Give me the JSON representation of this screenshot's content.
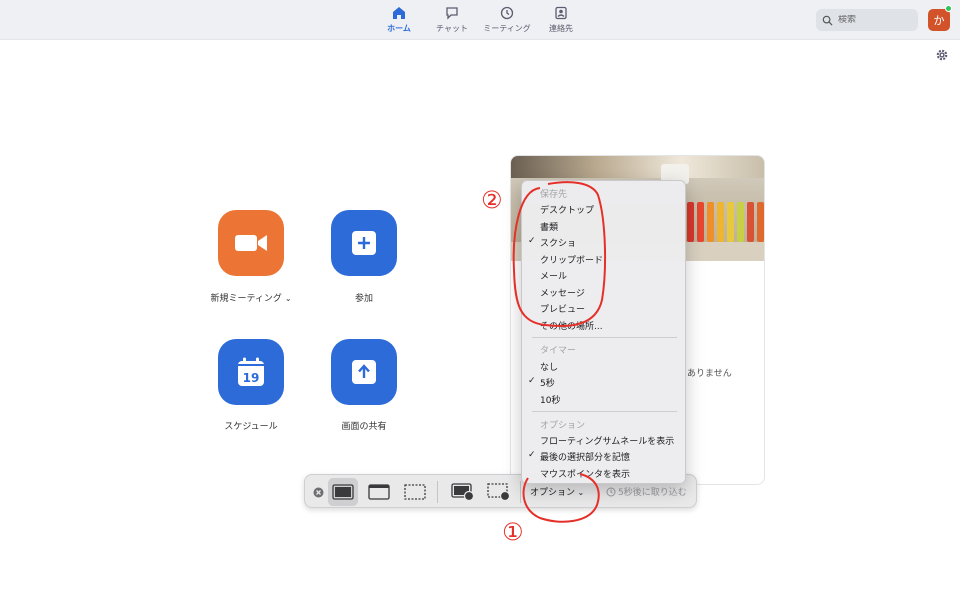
{
  "nav": {
    "items": [
      {
        "label": "ホーム",
        "icon": "home-icon",
        "active": true
      },
      {
        "label": "チャット",
        "icon": "chat-icon",
        "active": false
      },
      {
        "label": "ミーティング",
        "icon": "clock-icon",
        "active": false
      },
      {
        "label": "連絡先",
        "icon": "contacts-icon",
        "active": false
      }
    ]
  },
  "search": {
    "placeholder": "検索"
  },
  "avatar": {
    "initial": "か",
    "color": "#d2522a"
  },
  "home": {
    "new_meeting": "新規ミーティング",
    "join": "参加",
    "schedule": "スケジュール",
    "calendar_day": "19",
    "share_screen": "画面の共有"
  },
  "card": {
    "text": "ありません"
  },
  "menu": {
    "save_to_header": "保存先",
    "save_to": [
      {
        "label": "デスクトップ",
        "checked": false
      },
      {
        "label": "書類",
        "checked": false
      },
      {
        "label": "スクショ",
        "checked": true
      },
      {
        "label": "クリップボード",
        "checked": false
      },
      {
        "label": "メール",
        "checked": false
      },
      {
        "label": "メッセージ",
        "checked": false
      },
      {
        "label": "プレビュー",
        "checked": false
      },
      {
        "label": "その他の場所...",
        "checked": false
      }
    ],
    "timer_header": "タイマー",
    "timer": [
      {
        "label": "なし",
        "checked": false
      },
      {
        "label": "5秒",
        "checked": true
      },
      {
        "label": "10秒",
        "checked": false
      }
    ],
    "options_header": "オプション",
    "options": [
      {
        "label": "フローティングサムネールを表示",
        "checked": false
      },
      {
        "label": "最後の選択部分を記憶",
        "checked": true
      },
      {
        "label": "マウスポインタを表示",
        "checked": false
      }
    ]
  },
  "toolbar": {
    "options_label": "オプション",
    "capture_label": "5秒後に取り込む"
  },
  "annotations": {
    "step1": "①",
    "step2": "②"
  },
  "colors": {
    "accent": "#2d6bd8",
    "orange": "#ec7435",
    "annotation": "#e5302a"
  }
}
